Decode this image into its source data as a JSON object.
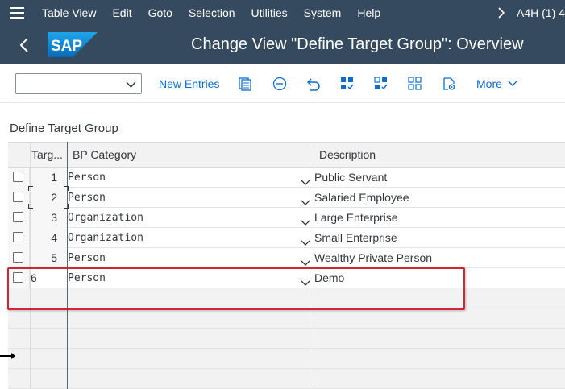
{
  "menubar": {
    "items": [
      "Table View",
      "Edit",
      "Goto",
      "Selection",
      "Utilities",
      "System",
      "Help"
    ],
    "system_info": "A4H (1) 4"
  },
  "header": {
    "logo_text": "SAP",
    "title": "Change View \"Define Target Group\": Overview"
  },
  "toolbar": {
    "command_field": {
      "value": "",
      "placeholder": ""
    },
    "new_entries_label": "New Entries",
    "icons": [
      "copy-as-icon",
      "delete-icon",
      "undo-icon",
      "select-all-icon",
      "select-block-icon",
      "deselect-all-icon",
      "configuration-icon"
    ],
    "more_label": "More"
  },
  "section": {
    "title": "Define Target Group"
  },
  "table": {
    "columns": [
      "Targ...",
      "BP Category",
      "Description"
    ],
    "rows": [
      {
        "id": "1",
        "category": "Person",
        "description": "Public Servant"
      },
      {
        "id": "2",
        "category": "Person",
        "description": "Salaried Employee"
      },
      {
        "id": "3",
        "category": "Organization",
        "description": "Large Enterprise"
      },
      {
        "id": "4",
        "category": "Organization",
        "description": "Small Enterprise"
      },
      {
        "id": "5",
        "category": "Person",
        "description": "Wealthy Private Person"
      },
      {
        "id": "6",
        "category": "Person",
        "description": "Demo"
      }
    ]
  },
  "colors": {
    "shell": "#354a5f",
    "link": "#0a6ed1",
    "highlight": "#d0262f"
  }
}
